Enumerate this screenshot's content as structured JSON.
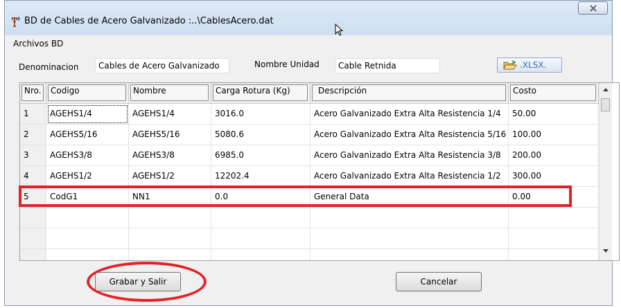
{
  "window": {
    "title": "BD de  Cables de Acero Galvanizado :..\\CablesAcero.dat",
    "close_icon": "close-x-icon"
  },
  "menu": {
    "archivos": "Archivos BD"
  },
  "form": {
    "denominacion_label": "Denominacion",
    "denominacion_value": "Cables de Acero Galvanizado",
    "nombre_unidad_label": "Nombre Unidad",
    "nombre_unidad_value": "Cable Retnida",
    "xlsx_button": ".XLSX."
  },
  "table": {
    "headers": [
      "Nro.",
      "Codigo",
      "Nombre",
      "Carga Rotura  (Kg)",
      "Descripción",
      "Costo"
    ],
    "rows": [
      {
        "nro": "1",
        "codigo": "AGEHS1/4",
        "nombre": "AGEHS1/4",
        "carga": "3016.0",
        "descripcion": "Acero Galvanizado Extra Alta Resistencia 1/4",
        "costo": "50.00"
      },
      {
        "nro": "2",
        "codigo": "AGEHS5/16",
        "nombre": "AGEHS5/16",
        "carga": "5080.6",
        "descripcion": "Acero Galvanizado Extra Alta Resistencia 5/16",
        "costo": "100.00"
      },
      {
        "nro": "3",
        "codigo": "AGEHS3/8",
        "nombre": "AGEHS3/8",
        "carga": "6985.0",
        "descripcion": "Acero Galvanizado Extra Alta Resistencia 3/8",
        "costo": "200.00"
      },
      {
        "nro": "4",
        "codigo": "AGEHS1/2",
        "nombre": "AGEHS1/2",
        "carga": "12202.4",
        "descripcion": "Acero Galvanizado Extra Alta Resistencia 1/2",
        "costo": "300.00"
      },
      {
        "nro": "5",
        "codigo": "CodG1",
        "nombre": "NN1",
        "carga": "0.0",
        "descripcion": "General Data",
        "costo": "0.00"
      }
    ]
  },
  "buttons": {
    "grabar": "Grabar y Salir",
    "cancelar": "Cancelar"
  },
  "annotation_color": "#e32228"
}
